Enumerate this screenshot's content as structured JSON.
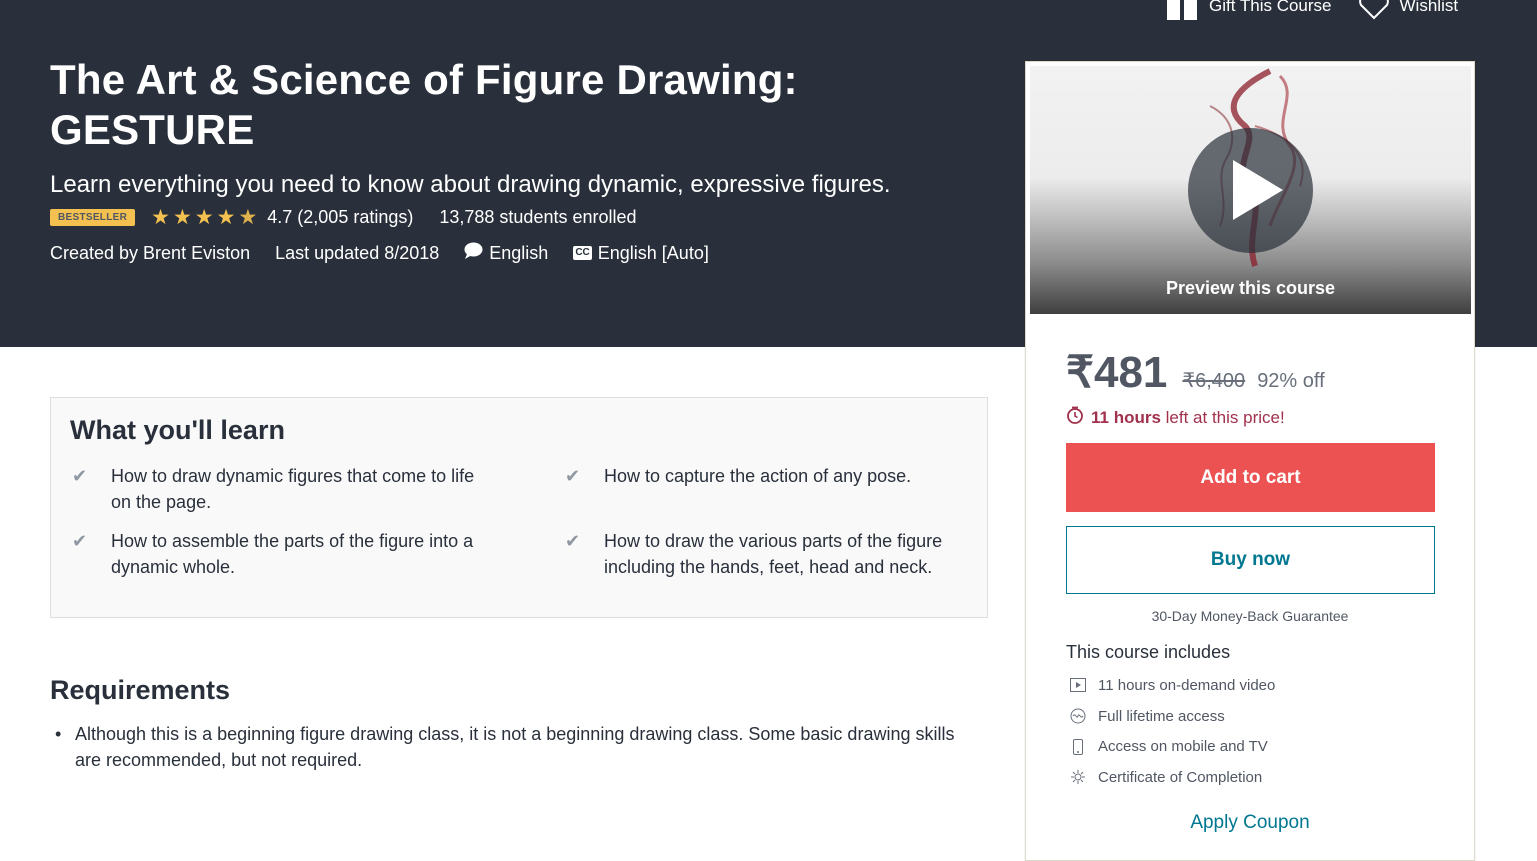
{
  "header": {
    "gift_label": "Gift This Course",
    "wishlist_label": "Wishlist",
    "title": "The Art & Science of Figure Drawing: GESTURE",
    "subtitle": "Learn everything you need to know about drawing dynamic, expressive figures.",
    "badge": "BESTSELLER",
    "rating": 4.7,
    "rating_text": "4.7 (2,005 ratings)",
    "students": "13,788 students enrolled",
    "created_by": "Created by Brent Eviston",
    "last_updated": "Last updated 8/2018",
    "language": "English",
    "captions": "English [Auto]",
    "colors": {
      "background": "#29303b",
      "star": "#f4c150"
    }
  },
  "sidebar": {
    "preview_label": "Preview this course",
    "price": "₹481",
    "original_price": "₹6,400",
    "discount": "92% off",
    "timer_bold": "11 hours",
    "timer_rest": " left at this price!",
    "add_to_cart": "Add to cart",
    "buy_now": "Buy now",
    "guarantee": "30-Day Money-Back Guarantee",
    "includes_title": "This course includes",
    "includes": [
      {
        "icon": "video-icon",
        "label": "11 hours on-demand video"
      },
      {
        "icon": "infinity-icon",
        "label": "Full lifetime access"
      },
      {
        "icon": "mobile-icon",
        "label": "Access on mobile and TV"
      },
      {
        "icon": "certificate-icon",
        "label": "Certificate of Completion"
      }
    ],
    "apply_coupon": "Apply Coupon",
    "colors": {
      "cart": "#ec5252",
      "link": "#007791",
      "timer": "#a1314d"
    }
  },
  "learn": {
    "title": "What you'll learn",
    "items": [
      "How to draw dynamic figures that come to life on the page.",
      "How to capture the action of any pose.",
      "How to assemble the parts of the figure into a dynamic whole.",
      "How to draw the various parts of the figure including the hands, feet, head and neck."
    ]
  },
  "requirements": {
    "title": "Requirements",
    "items": [
      "Although this is a beginning figure drawing class, it is not a beginning drawing class. Some basic drawing skills are recommended, but not required."
    ]
  }
}
